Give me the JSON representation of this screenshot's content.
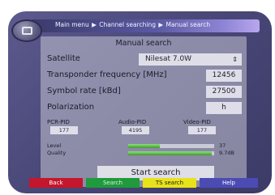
{
  "breadcrumb": [
    "Main menu",
    "Channel searching",
    "Manual search"
  ],
  "breadcrumb_sep": "▶",
  "title": "Manual search",
  "fields": {
    "satellite": {
      "label": "Satellite",
      "value": "Nilesat 7.0W"
    },
    "transponder": {
      "label": "Transponder frequency [MHz]",
      "value": "12456"
    },
    "symbol_rate": {
      "label": "Symbol rate [kBd]",
      "value": "27500"
    },
    "polarization": {
      "label": "Polarization",
      "value": "h"
    }
  },
  "pids": {
    "pcr": {
      "label": "PCR-PID",
      "value": "177"
    },
    "audio": {
      "label": "Audio-PID",
      "value": "4195"
    },
    "video": {
      "label": "Video-PID",
      "value": "177"
    }
  },
  "signal": {
    "level": {
      "label": "Level",
      "value": "37",
      "fraction": 0.37
    },
    "quality": {
      "label": "Quality",
      "value": "9.7dB",
      "fraction": 0.97
    }
  },
  "start_button": "Start search",
  "color_keys": {
    "red": "Back",
    "green": "Search",
    "yellow": "TS search",
    "blue": "Help"
  },
  "colors": {
    "red_key": "#c4162c",
    "green_key": "#1f9a3c",
    "yellow_key": "#e8e21a",
    "blue_key": "#4b4bb4",
    "meter_fill": "#3f9a31"
  },
  "icons": {
    "menu": "tv-menu-icon",
    "dropdown": "dropdown-arrow-icon"
  }
}
